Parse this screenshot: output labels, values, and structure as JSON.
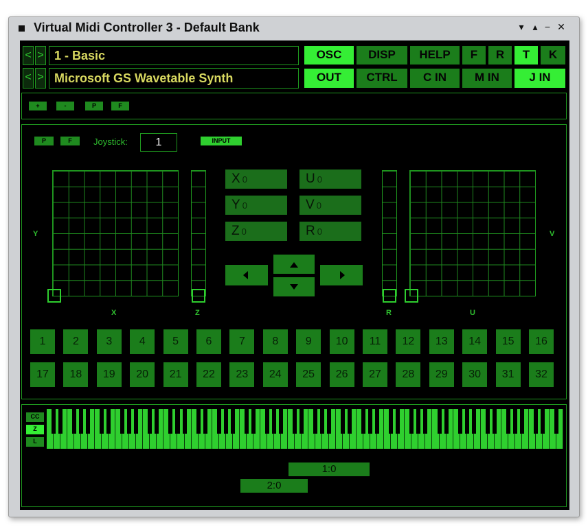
{
  "window": {
    "title": "Virtual Midi Controller 3 - Default Bank",
    "controls": {
      "menu": "▾",
      "minimize": "▴",
      "restore": "−",
      "close": "✕"
    }
  },
  "top": {
    "preset_name": "1 - Basic",
    "device_name": "Microsoft GS Wavetable Synth",
    "nav": {
      "prev": "<",
      "next": ">"
    },
    "row1_buttons": [
      {
        "label": "OSC",
        "active": true
      },
      {
        "label": "DISP",
        "active": false
      },
      {
        "label": "HELP",
        "active": false
      },
      {
        "label": "F",
        "active": false
      },
      {
        "label": "R",
        "active": false
      },
      {
        "label": "T",
        "active": true
      },
      {
        "label": "K",
        "active": false
      }
    ],
    "row2_buttons": [
      {
        "label": "OUT",
        "active": true
      },
      {
        "label": "CTRL",
        "active": false
      },
      {
        "label": "C IN",
        "active": false
      },
      {
        "label": "M IN",
        "active": false
      },
      {
        "label": "J IN",
        "active": true
      }
    ]
  },
  "toolbar": {
    "buttons": [
      "+",
      "-",
      "P",
      "F"
    ]
  },
  "joystick": {
    "p_label": "P",
    "f_label": "F",
    "joystick_label": "Joystick:",
    "joystick_value": "1",
    "input_label": "INPUT",
    "axes": {
      "y": "Y",
      "x": "X",
      "z": "Z",
      "r": "R",
      "u": "U",
      "v": "V"
    },
    "values": [
      {
        "axis": "X",
        "value": "0"
      },
      {
        "axis": "U",
        "value": "0"
      },
      {
        "axis": "Y",
        "value": "0"
      },
      {
        "axis": "V",
        "value": "0"
      },
      {
        "axis": "Z",
        "value": "0"
      },
      {
        "axis": "R",
        "value": "0"
      }
    ],
    "arrows": {
      "left": "◀",
      "up": "▲",
      "down": "▼",
      "right": "▶"
    }
  },
  "buttons_grid": [
    "1",
    "2",
    "3",
    "4",
    "5",
    "6",
    "7",
    "8",
    "9",
    "10",
    "11",
    "12",
    "13",
    "14",
    "15",
    "16",
    "17",
    "18",
    "19",
    "20",
    "21",
    "22",
    "23",
    "24",
    "25",
    "26",
    "27",
    "28",
    "29",
    "30",
    "31",
    "32"
  ],
  "keyboard": {
    "side_buttons": [
      "CC",
      "Z",
      "L"
    ],
    "position_1": "1:0",
    "position_2": "2:0"
  },
  "colors": {
    "accent": "#35ee35",
    "button": "#1b7d1b",
    "border": "#1f9a1f",
    "field_text": "#d8d860"
  }
}
